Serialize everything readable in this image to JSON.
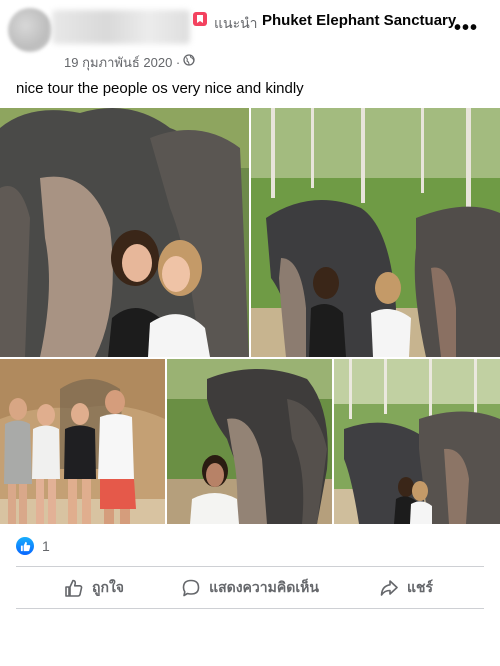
{
  "header": {
    "recommend_label": "แนะนำ",
    "page_name": "Phuket Elephant Sanctuary",
    "more_label": "•••",
    "date": "19 กุมภาพันธ์ 2020 ·",
    "privacy_icon": "globe-icon",
    "recommend_icon": "recommend-icon"
  },
  "post": {
    "text": "nice tour the people os very nice and kindly",
    "photos": [
      {
        "name": "photo-two-girls-with-elephant"
      },
      {
        "name": "photo-girls-with-elephants-forest"
      },
      {
        "name": "photo-family-group"
      },
      {
        "name": "photo-woman-with-elephant"
      },
      {
        "name": "photo-girls-with-two-elephants"
      }
    ]
  },
  "reactions": {
    "count": "1",
    "icon": "like-badge-icon"
  },
  "actions": {
    "like_label": "ถูกใจ",
    "comment_label": "แสดงความคิดเห็น",
    "share_label": "แชร์"
  },
  "colors": {
    "secondary_text": "#65676b",
    "like_blue": "#0866ff",
    "recommend_red": "#f3425f",
    "divider": "#ced0d4"
  }
}
